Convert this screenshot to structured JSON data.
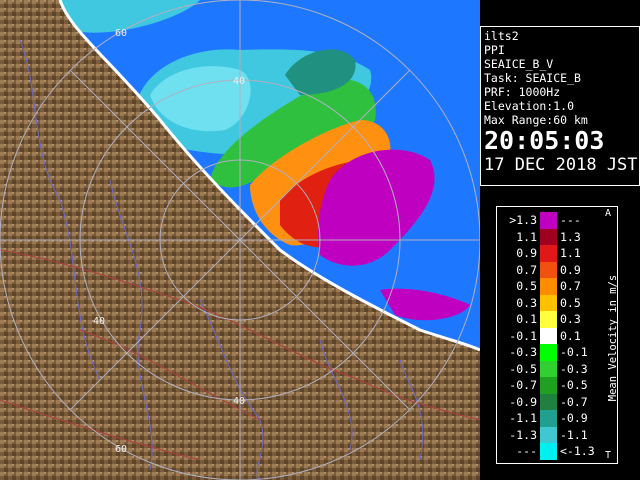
{
  "range_labels": [
    "60",
    "40",
    "40",
    "40",
    "60"
  ],
  "info": {
    "station": "ilts2",
    "mode": "PPI",
    "scan": "SEAICE_B_V",
    "task": "Task: SEAICE_B",
    "prf": "PRF: 1000Hz",
    "elevation": "Elevation:1.0",
    "max_range": "Max Range:60 km",
    "time": "20:05:03",
    "date": "17 DEC 2018 JST"
  },
  "legend": {
    "unit": "Mean Velocity in m/s",
    "corner_top": "A",
    "corner_bottom": "T",
    "rows": [
      {
        "lo": ">1.3",
        "hi": "---",
        "color": "#c000c0"
      },
      {
        "lo": "1.1",
        "hi": "1.3",
        "color": "#a00020"
      },
      {
        "lo": "0.9",
        "hi": "1.1",
        "color": "#e01818"
      },
      {
        "lo": "0.7",
        "hi": "0.9",
        "color": "#f05010"
      },
      {
        "lo": "0.5",
        "hi": "0.7",
        "color": "#ff8c00"
      },
      {
        "lo": "0.3",
        "hi": "0.5",
        "color": "#ffc000"
      },
      {
        "lo": "0.1",
        "hi": "0.3",
        "color": "#ffff40"
      },
      {
        "lo": "-0.1",
        "hi": "0.1",
        "color": "#ffffff"
      },
      {
        "lo": "-0.3",
        "hi": "-0.1",
        "color": "#00ff00"
      },
      {
        "lo": "-0.5",
        "hi": "-0.3",
        "color": "#30d030"
      },
      {
        "lo": "-0.7",
        "hi": "-0.5",
        "color": "#20a020"
      },
      {
        "lo": "-0.9",
        "hi": "-0.7",
        "color": "#208040"
      },
      {
        "lo": "-1.1",
        "hi": "-0.9",
        "color": "#20a090"
      },
      {
        "lo": "-1.3",
        "hi": "-1.1",
        "color": "#40c8d0"
      },
      {
        "lo": "---",
        "hi": "<-1.3",
        "color": "#00f0f0"
      }
    ]
  },
  "colors": {
    "sea": "#1e78ff",
    "land": "#8a6a45",
    "rings": "#a0a0b0"
  }
}
